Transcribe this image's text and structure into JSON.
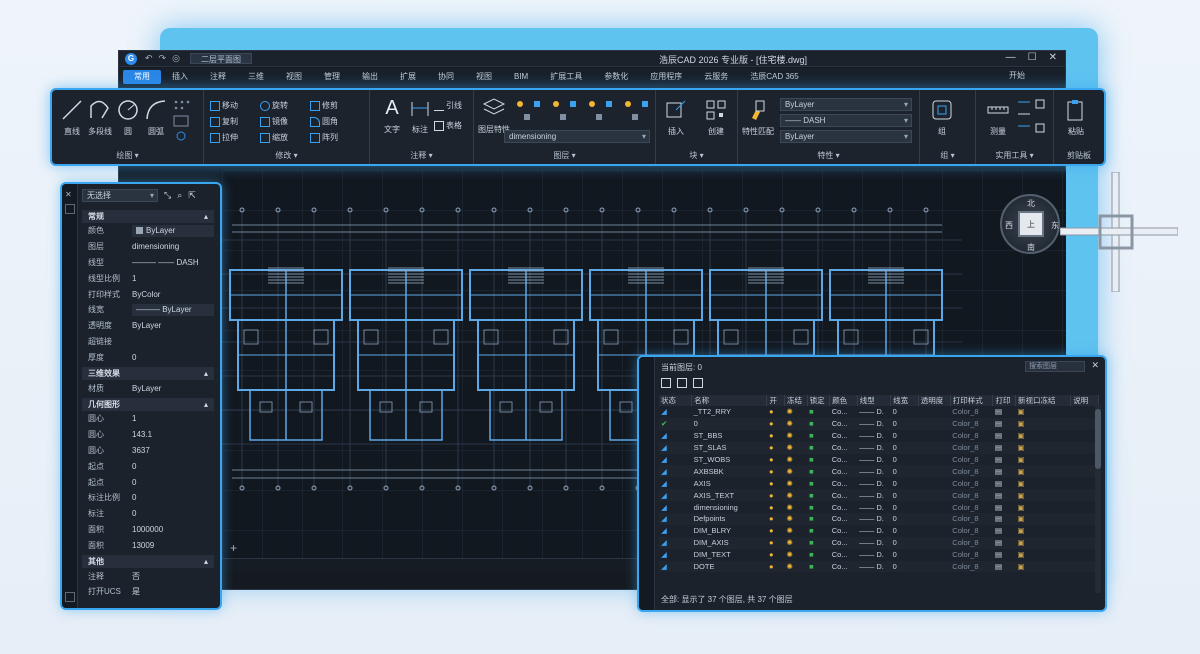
{
  "window": {
    "title": "浩辰CAD 2026 专业版 - [住宅楼.dwg]",
    "doc_tab": "二层平面图",
    "controls": [
      "—",
      "☐",
      "✕"
    ],
    "help_label": "开始",
    "help_controls": "? — ✕"
  },
  "ribbon_tabs": [
    "常用",
    "插入",
    "注释",
    "三维",
    "视图",
    "管理",
    "输出",
    "扩展",
    "协同",
    "视图",
    "BIM",
    "扩展工具",
    "参数化",
    "应用程序",
    "云服务",
    "浩辰CAD 365"
  ],
  "ribbon": {
    "draw": {
      "title": "绘图 ▾",
      "tools": [
        "直线",
        "多段线",
        "圆",
        "圆弧"
      ]
    },
    "modify": {
      "title": "修改 ▾",
      "tools": [
        "移动",
        "旋转",
        "修剪",
        "复制",
        "镜像",
        "圆角",
        "拉伸",
        "缩放",
        "阵列"
      ]
    },
    "annotate": {
      "title": "注释 ▾",
      "tools": [
        "文字",
        "标注",
        "引线",
        "表格"
      ]
    },
    "layers": {
      "title": "图层 ▾",
      "tools": [
        "图层特性"
      ],
      "current_layer": "dimensioning"
    },
    "block": {
      "title": "块 ▾",
      "tools": [
        "插入",
        "创建"
      ]
    },
    "properties": {
      "title": "特性 ▾",
      "tools": [
        "特性匹配"
      ],
      "combo1": "ByLayer",
      "combo2": "—— DASH",
      "combo3": "ByLayer"
    },
    "groups": {
      "title": "组 ▾",
      "tools": [
        "组"
      ]
    },
    "utilities": {
      "title": "实用工具 ▾",
      "tools": [
        "测量"
      ]
    },
    "clipboard": {
      "title": "剪贴板",
      "tools": [
        "粘贴"
      ]
    }
  },
  "properties_panel": {
    "selector": "无选择",
    "sections": [
      {
        "title": "常规",
        "rows": [
          {
            "k": "颜色",
            "v": "ByLayer",
            "swatch": true
          },
          {
            "k": "图层",
            "v": "dimensioning"
          },
          {
            "k": "线型",
            "v": "——— —— DASH"
          },
          {
            "k": "线型比例",
            "v": "1"
          },
          {
            "k": "打印样式",
            "v": "ByColor"
          },
          {
            "k": "线宽",
            "v": "——— ByLayer"
          },
          {
            "k": "透明度",
            "v": "ByLayer"
          },
          {
            "k": "超链接",
            "v": ""
          },
          {
            "k": "厚度",
            "v": "0"
          }
        ]
      },
      {
        "title": "三维效果",
        "rows": [
          {
            "k": "材质",
            "v": "ByLayer"
          }
        ]
      },
      {
        "title": "几何图形",
        "rows": [
          {
            "k": "圆心",
            "v": "1"
          },
          {
            "k": "圆心",
            "v": "143.1"
          },
          {
            "k": "圆心",
            "v": "3637"
          },
          {
            "k": "起点",
            "v": "0"
          },
          {
            "k": "起点",
            "v": "0"
          },
          {
            "k": "标注比例",
            "v": "0"
          },
          {
            "k": "标注",
            "v": "0"
          },
          {
            "k": "面积",
            "v": "1000000"
          },
          {
            "k": "面积",
            "v": "13009"
          }
        ]
      },
      {
        "title": "其他",
        "rows": [
          {
            "k": "注释",
            "v": "否"
          },
          {
            "k": "打开UCS",
            "v": "是"
          }
        ]
      }
    ]
  },
  "layer_manager": {
    "title": "当前图层: 0",
    "search_placeholder": "搜索图层",
    "headers": [
      "状态",
      "名称",
      "开",
      "冻结",
      "锁定",
      "颜色",
      "线型",
      "线宽",
      "透明度",
      "打印样式",
      "打印",
      "新视口冻结",
      "说明"
    ],
    "rows": [
      {
        "status": "◢",
        "name": "_TT2_RRY",
        "color": "Co...",
        "lw": "—— D.",
        "tr": "0",
        "ps": "Color_8"
      },
      {
        "status": "✔",
        "name": "0",
        "color": "Co...",
        "lw": "—— D.",
        "tr": "0",
        "ps": "Color_8"
      },
      {
        "status": "◢",
        "name": "ST_BBS",
        "color": "Co...",
        "lw": "—— D.",
        "tr": "0",
        "ps": "Color_8"
      },
      {
        "status": "◢",
        "name": "ST_SLAS",
        "color": "Co...",
        "lw": "—— D.",
        "tr": "0",
        "ps": "Color_8"
      },
      {
        "status": "◢",
        "name": "ST_WOBS",
        "color": "Co...",
        "lw": "—— D.",
        "tr": "0",
        "ps": "Color_8"
      },
      {
        "status": "◢",
        "name": "AXBSBK",
        "color": "Co...",
        "lw": "—— D.",
        "tr": "0",
        "ps": "Color_8"
      },
      {
        "status": "◢",
        "name": "AXIS",
        "color": "Co...",
        "lw": "—— D.",
        "tr": "0",
        "ps": "Color_8"
      },
      {
        "status": "◢",
        "name": "AXIS_TEXT",
        "color": "Co...",
        "lw": "—— D.",
        "tr": "0",
        "ps": "Color_8"
      },
      {
        "status": "◢",
        "name": "dimensioning",
        "color": "Co...",
        "lw": "—— D.",
        "tr": "0",
        "ps": "Color_8"
      },
      {
        "status": "◢",
        "name": "Defpoints",
        "color": "Co...",
        "lw": "—— D.",
        "tr": "0",
        "ps": "Color_8"
      },
      {
        "status": "◢",
        "name": "DIM_BLRY",
        "color": "Co...",
        "lw": "—— D.",
        "tr": "0",
        "ps": "Color_8"
      },
      {
        "status": "◢",
        "name": "DIM_AXIS",
        "color": "Co...",
        "lw": "—— D.",
        "tr": "0",
        "ps": "Color_8"
      },
      {
        "status": "◢",
        "name": "DIM_TEXT",
        "color": "Co...",
        "lw": "—— D.",
        "tr": "0",
        "ps": "Color_8"
      },
      {
        "status": "◢",
        "name": "DOTE",
        "color": "Co...",
        "lw": "—— D.",
        "tr": "0",
        "ps": "Color_8"
      }
    ],
    "footer": "全部: 显示了 37 个图层, 共 37 个图层"
  },
  "viewcube": {
    "face": "上",
    "north": "北",
    "west": "西",
    "east": "东",
    "south": "南"
  },
  "colors": {
    "accent": "#2a86e6",
    "glow": "#3aa6f0",
    "drawing_lines": "#5ea8e6",
    "canvas": "#121820"
  }
}
